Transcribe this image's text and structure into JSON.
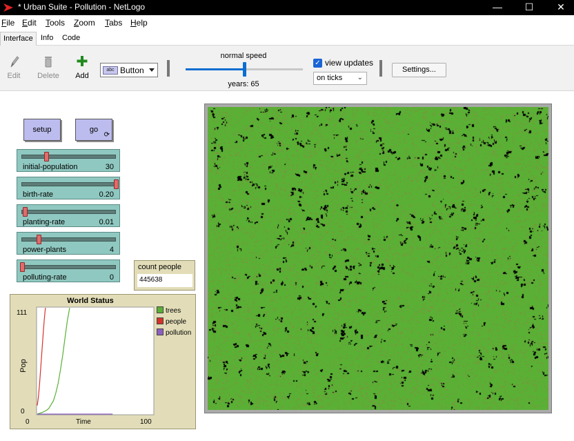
{
  "window": {
    "title": "* Urban Suite - Pollution - NetLogo",
    "minimize": "—",
    "maximize": "☐",
    "close": "✕"
  },
  "menu": {
    "items": [
      {
        "key": "F",
        "rest": "ile"
      },
      {
        "key": "E",
        "rest": "dit"
      },
      {
        "key": "T",
        "rest": "ools"
      },
      {
        "key": "Z",
        "rest": "oom"
      },
      {
        "key": "T",
        "rest": "abs"
      },
      {
        "key": "H",
        "rest": "elp"
      }
    ]
  },
  "tabs": [
    "Interface",
    "Info",
    "Code"
  ],
  "toolbar": {
    "edit_label": "Edit",
    "delete_label": "Delete",
    "add_label": "Add",
    "widget_type": "Button",
    "widget_icon_text": "abc",
    "speed_label": "normal speed",
    "speed_level": 0.5,
    "ticks_label": "years: 65",
    "view_updates_label": "view updates",
    "view_updates_checked": true,
    "update_mode": "on ticks",
    "settings_label": "Settings..."
  },
  "buttons": {
    "setup_label": "setup",
    "go_label": "go"
  },
  "sliders": [
    {
      "name": "initial-population",
      "value": "30",
      "position": 0.26
    },
    {
      "name": "birth-rate",
      "value": "0.20",
      "position": 1.0
    },
    {
      "name": "planting-rate",
      "value": "0.01",
      "position": 0.03
    },
    {
      "name": "power-plants",
      "value": "4",
      "position": 0.18
    },
    {
      "name": "polluting-rate",
      "value": "0",
      "position": 0.0
    }
  ],
  "monitor": {
    "label": "count people",
    "value": "445638"
  },
  "plot": {
    "title": "World Status",
    "ymax": "111",
    "ymin": "0",
    "xmin": "0",
    "xmax": "100",
    "xlabel": "Time",
    "ylabel": "Pop",
    "legend": [
      {
        "name": "trees",
        "color": "#59b035"
      },
      {
        "name": "people",
        "color": "#d73229"
      },
      {
        "name": "pollution",
        "color": "#8c5fc2"
      }
    ]
  },
  "chart_data": {
    "type": "line",
    "title": "World Status",
    "xlabel": "Time",
    "ylabel": "Pop",
    "xlim": [
      0,
      100
    ],
    "ylim": [
      0,
      111
    ],
    "legend": "right",
    "series": [
      {
        "name": "trees",
        "color": "#59b035",
        "x": [
          0,
          5,
          8,
          10,
          12,
          14,
          16,
          18,
          20,
          22,
          24,
          26,
          28
        ],
        "y": [
          0,
          2,
          4,
          6,
          10,
          14,
          22,
          32,
          46,
          62,
          80,
          98,
          111
        ]
      },
      {
        "name": "people",
        "color": "#d73229",
        "x": [
          0,
          1,
          2,
          3,
          4,
          5,
          6,
          7
        ],
        "y": [
          9,
          18,
          32,
          48,
          65,
          82,
          98,
          111
        ]
      },
      {
        "name": "pollution",
        "color": "#8c5fc2",
        "x": [
          0,
          65
        ],
        "y": [
          0,
          0
        ]
      }
    ]
  },
  "world": {
    "background": "#59b035",
    "speckle": "#a07a4a",
    "pollution": "#000000"
  }
}
